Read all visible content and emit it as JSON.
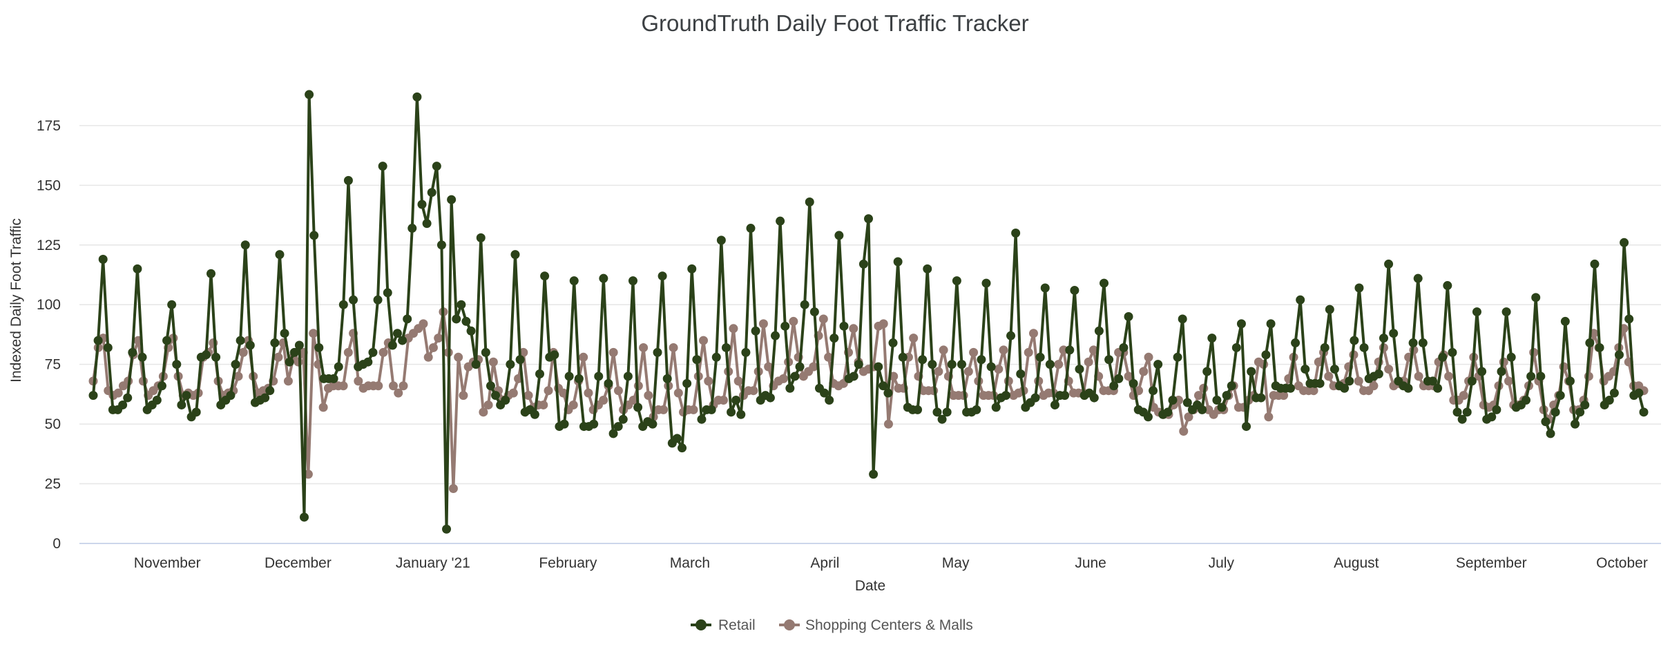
{
  "chart_data": {
    "type": "line",
    "title": "GroundTruth Daily Foot Traffic Tracker",
    "xlabel": "Date",
    "ylabel": "Indexed Daily Foot Traffic",
    "ylim": [
      0,
      190
    ],
    "yticks": [
      0,
      25,
      50,
      75,
      100,
      125,
      150,
      175
    ],
    "grid": true,
    "legend_position": "bottom-center",
    "x_start_date": "2020-10-15",
    "x_end_date": "2021-10-06",
    "xtick_labels": [
      {
        "label": "November",
        "date": "2020-11-01"
      },
      {
        "label": "December",
        "date": "2020-12-01"
      },
      {
        "label": "January '21",
        "date": "2021-01-01"
      },
      {
        "label": "February",
        "date": "2021-02-01"
      },
      {
        "label": "March",
        "date": "2021-03-01"
      },
      {
        "label": "April",
        "date": "2021-04-01"
      },
      {
        "label": "May",
        "date": "2021-05-01"
      },
      {
        "label": "June",
        "date": "2021-06-01"
      },
      {
        "label": "July",
        "date": "2021-07-01"
      },
      {
        "label": "August",
        "date": "2021-08-01"
      },
      {
        "label": "September",
        "date": "2021-09-01"
      },
      {
        "label": "October",
        "date": "2021-10-01"
      }
    ],
    "series": [
      {
        "name": "Retail",
        "color": "#2b4219",
        "values": [
          62,
          85,
          119,
          82,
          56,
          56,
          58,
          61,
          80,
          115,
          78,
          56,
          58,
          60,
          66,
          85,
          100,
          75,
          58,
          62,
          53,
          55,
          78,
          79,
          113,
          78,
          58,
          60,
          62,
          75,
          85,
          125,
          83,
          59,
          60,
          61,
          64,
          84,
          121,
          88,
          76,
          80,
          83,
          11,
          188,
          129,
          82,
          69,
          69,
          69,
          74,
          100,
          152,
          102,
          74,
          75,
          76,
          80,
          102,
          158,
          105,
          83,
          88,
          85,
          94,
          132,
          187,
          142,
          134,
          147,
          158,
          125,
          6,
          144,
          94,
          100,
          93,
          89,
          75,
          128,
          80,
          66,
          62,
          58,
          60,
          75,
          121,
          77,
          55,
          56,
          54,
          71,
          112,
          78,
          79,
          49,
          50,
          70,
          110,
          69,
          49,
          49,
          50,
          70,
          111,
          67,
          46,
          49,
          52,
          70,
          110,
          57,
          49,
          51,
          50,
          80,
          112,
          69,
          42,
          44,
          40,
          67,
          115,
          77,
          52,
          56,
          56,
          78,
          127,
          82,
          55,
          60,
          54,
          80,
          132,
          89,
          60,
          62,
          61,
          87,
          135,
          91,
          65,
          70,
          74,
          100,
          143,
          97,
          65,
          63,
          60,
          86,
          129,
          91,
          69,
          70,
          75,
          117,
          136,
          29,
          74,
          66,
          63,
          84,
          118,
          78,
          57,
          56,
          56,
          77,
          115,
          75,
          55,
          52,
          55,
          75,
          110,
          75,
          55,
          55,
          56,
          77,
          109,
          74,
          57,
          61,
          62,
          87,
          130,
          71,
          57,
          59,
          61,
          78,
          107,
          75,
          58,
          62,
          62,
          81,
          106,
          73,
          62,
          63,
          61,
          89,
          109,
          77,
          66,
          69,
          82,
          95,
          67,
          56,
          55,
          53,
          64,
          75,
          54,
          55,
          60,
          78,
          94,
          59,
          56,
          58,
          56,
          72,
          86,
          60,
          57,
          62,
          66,
          82,
          92,
          49,
          72,
          61,
          61,
          79,
          92,
          66,
          65,
          65,
          65,
          84,
          102,
          73,
          67,
          67,
          67,
          82,
          98,
          73,
          66,
          65,
          68,
          85,
          107,
          82,
          69,
          70,
          71,
          86,
          117,
          88,
          68,
          66,
          65,
          84,
          111,
          84,
          68,
          68,
          65,
          78,
          108,
          80,
          55,
          52,
          55,
          68,
          97,
          72,
          52,
          53,
          56,
          72,
          97,
          78,
          57,
          58,
          60,
          70,
          103,
          70,
          51,
          46,
          55,
          62,
          93,
          68,
          50,
          55,
          58,
          84,
          117,
          82,
          58,
          60,
          63,
          79,
          126,
          94,
          62,
          63,
          55
        ]
      },
      {
        "name": "Shopping Centers & Malls",
        "color": "#957a72",
        "values": [
          68,
          82,
          86,
          64,
          62,
          63,
          66,
          68,
          79,
          85,
          68,
          62,
          64,
          66,
          70,
          82,
          86,
          70,
          62,
          63,
          62,
          63,
          78,
          80,
          84,
          68,
          62,
          63,
          64,
          70,
          80,
          85,
          70,
          63,
          64,
          65,
          68,
          78,
          84,
          68,
          78,
          76,
          80,
          29,
          88,
          75,
          57,
          65,
          66,
          66,
          66,
          80,
          88,
          68,
          65,
          66,
          66,
          66,
          80,
          84,
          66,
          63,
          66,
          86,
          88,
          90,
          92,
          78,
          82,
          86,
          97,
          80,
          23,
          78,
          62,
          74,
          76,
          77,
          55,
          58,
          76,
          64,
          60,
          62,
          63,
          69,
          80,
          62,
          57,
          58,
          58,
          64,
          80,
          65,
          63,
          56,
          58,
          68,
          78,
          63,
          56,
          58,
          60,
          66,
          80,
          64,
          56,
          58,
          60,
          66,
          82,
          62,
          53,
          56,
          56,
          66,
          82,
          63,
          55,
          56,
          56,
          70,
          85,
          68,
          58,
          60,
          60,
          72,
          90,
          68,
          62,
          64,
          64,
          72,
          92,
          74,
          66,
          68,
          69,
          76,
          93,
          78,
          70,
          72,
          74,
          87,
          94,
          78,
          67,
          66,
          67,
          80,
          90,
          76,
          72,
          73,
          74,
          91,
          92,
          50,
          70,
          65,
          65,
          78,
          86,
          70,
          64,
          64,
          64,
          72,
          81,
          70,
          62,
          62,
          62,
          72,
          80,
          68,
          62,
          62,
          62,
          73,
          81,
          68,
          62,
          63,
          64,
          80,
          88,
          68,
          62,
          63,
          63,
          75,
          81,
          68,
          63,
          63,
          63,
          76,
          81,
          70,
          64,
          64,
          64,
          80,
          80,
          70,
          62,
          64,
          72,
          78,
          57,
          55,
          54,
          54,
          58,
          60,
          47,
          53,
          56,
          62,
          65,
          56,
          54,
          56,
          56,
          62,
          66,
          57,
          57,
          60,
          62,
          76,
          75,
          53,
          62,
          62,
          62,
          69,
          78,
          66,
          64,
          64,
          64,
          76,
          80,
          70,
          66,
          66,
          67,
          74,
          79,
          68,
          64,
          64,
          66,
          76,
          82,
          73,
          66,
          67,
          68,
          78,
          81,
          70,
          66,
          66,
          66,
          76,
          79,
          70,
          60,
          60,
          62,
          68,
          78,
          70,
          58,
          57,
          58,
          66,
          76,
          68,
          58,
          58,
          60,
          66,
          80,
          68,
          56,
          52,
          58,
          62,
          74,
          68,
          56,
          56,
          60,
          70,
          88,
          82,
          68,
          70,
          72,
          82,
          90,
          76,
          66,
          66,
          64
        ]
      }
    ]
  }
}
